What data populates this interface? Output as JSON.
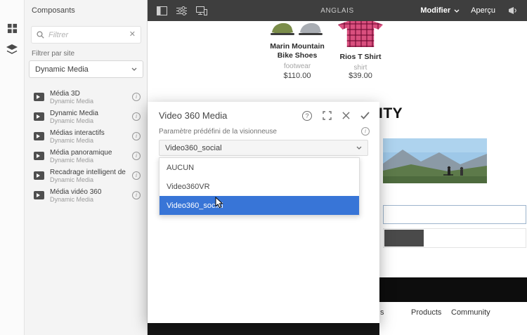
{
  "colors": {
    "topbar_bg": "#3e3e3e",
    "sidebar_bg": "#f4f4f4",
    "accent_blue": "#3875d7",
    "footer_dark": "#0d0d0d"
  },
  "sidebar": {
    "title": "Composants",
    "search_placeholder": "Filtrer",
    "filter_by_site_label": "Filtrer par site",
    "site_filter_value": "Dynamic Media",
    "components": [
      {
        "title": "Média 3D",
        "group": "Dynamic Media"
      },
      {
        "title": "Dynamic Media",
        "group": "Dynamic Media"
      },
      {
        "title": "Médias interactifs",
        "group": "Dynamic Media"
      },
      {
        "title": "Média panoramique",
        "group": "Dynamic Media"
      },
      {
        "title": "Recadrage intelligent de la...",
        "group": "Dynamic Media"
      },
      {
        "title": "Média vidéo 360",
        "group": "Dynamic Media"
      }
    ]
  },
  "topbar": {
    "locale": "ANGLAIS",
    "mode_label": "Modifier",
    "preview_label": "Aperçu"
  },
  "page": {
    "products": [
      {
        "name": "Marin Mountain Bike Shoes",
        "category": "footwear",
        "price": "$110.00"
      },
      {
        "name": "Rios T Shirt",
        "category": "shirt",
        "price": "$39.00"
      }
    ],
    "heading_fragment": "ITY",
    "footer_links": [
      "s",
      "Products",
      "Community"
    ]
  },
  "dialog": {
    "title": "Video 360 Media",
    "field_label": "Paramètre prédéfini de la visionneuse",
    "select_value": "Video360_social",
    "options": [
      {
        "label": "AUCUN",
        "selected": false
      },
      {
        "label": "Video360VR",
        "selected": false
      },
      {
        "label": "Video360_social",
        "selected": true
      }
    ]
  }
}
